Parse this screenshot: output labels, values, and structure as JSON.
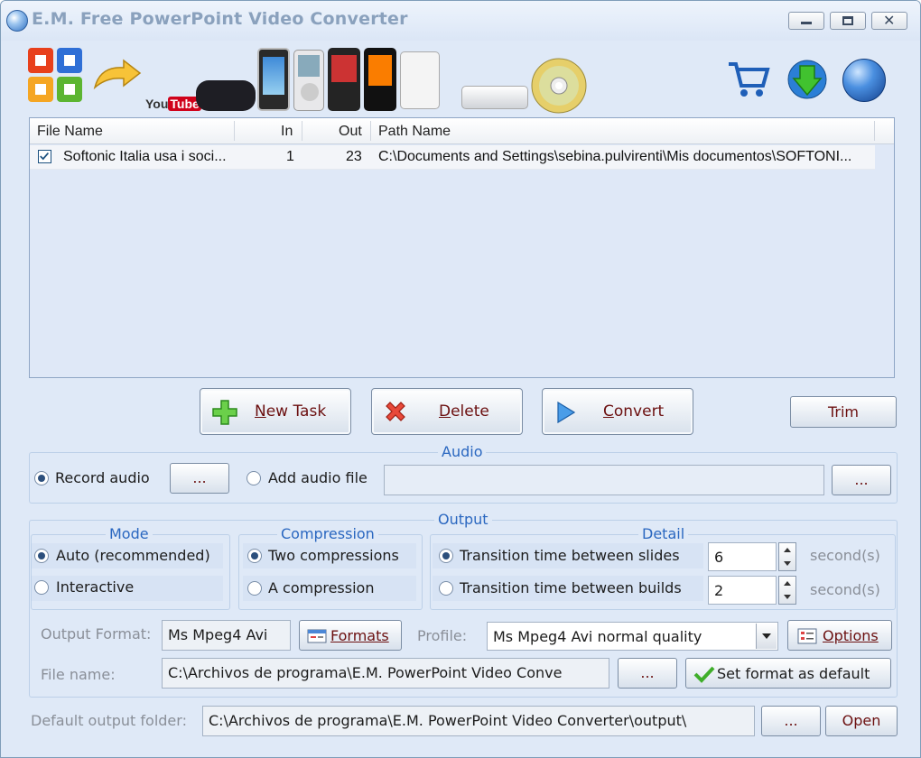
{
  "window": {
    "title": "E.M. Free PowerPoint Video Converter"
  },
  "banner": {
    "youtube_you": "You",
    "youtube_tube": "Tube"
  },
  "list": {
    "columns": [
      "File Name",
      "In",
      "Out",
      "Path Name"
    ],
    "rows": [
      {
        "checked": true,
        "file_name": "Softonic Italia usa i soci...",
        "in": "1",
        "out": "23",
        "path": "C:\\Documents and Settings\\sebina.pulvirenti\\Mis documentos\\SOFTONI..."
      }
    ]
  },
  "actions": {
    "new_task": "New Task",
    "delete": "Delete",
    "convert": "Convert",
    "trim": "Trim"
  },
  "audio": {
    "title": "Audio",
    "record_label": "Record audio",
    "record_browse": "...",
    "add_file_label": "Add audio file",
    "file_value": "",
    "file_browse": "..."
  },
  "output": {
    "title": "Output",
    "mode": {
      "title": "Mode",
      "auto": "Auto (recommended)",
      "interactive": "Interactive"
    },
    "compression": {
      "title": "Compression",
      "two": "Two compressions",
      "one": "A compression"
    },
    "detail": {
      "title": "Detail",
      "slides_label": "Transition time between slides",
      "slides_value": "6",
      "builds_label": "Transition time between builds",
      "builds_value": "2",
      "unit": "second(s)"
    },
    "format_label": "Output Format:",
    "format_value": "Ms Mpeg4 Avi",
    "formats_button": "Formats",
    "profile_label": "Profile:",
    "profile_value": "Ms Mpeg4 Avi normal quality",
    "options_button": "Options",
    "filename_label": "File name:",
    "filename_value": "C:\\Archivos de programa\\E.M. PowerPoint Video Conve",
    "filename_browse": "...",
    "set_default_button": "Set format as default"
  },
  "folder": {
    "label": "Default output folder:",
    "value": "C:\\Archivos de programa\\E.M. PowerPoint Video Converter\\output\\",
    "browse": "...",
    "open": "Open"
  }
}
